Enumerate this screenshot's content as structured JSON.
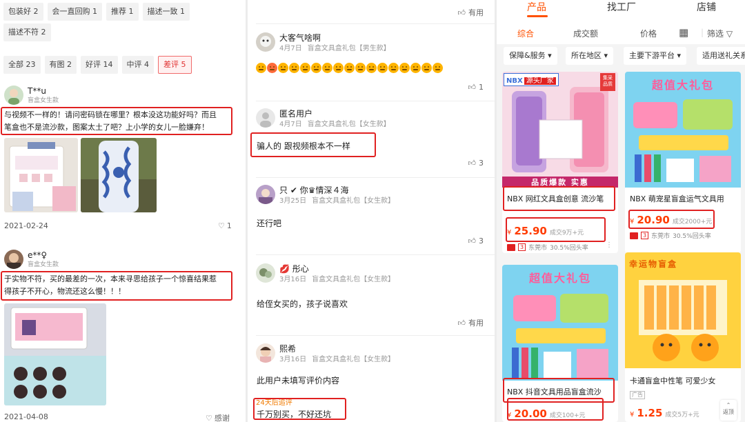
{
  "left": {
    "chips_row1": [
      "包装好 2",
      "会一直回购 1",
      "推荐 1",
      "描述一致 1"
    ],
    "chip_row2": "描述不符 2",
    "filters": [
      "全部 23",
      "有图 2",
      "好评 14",
      "中评 4",
      "差评 5"
    ],
    "reviews": [
      {
        "user": "T**u",
        "tag": "盲盒女生款",
        "text_line1": "与视频不一样的！请问密码锁在哪里？根本没这功能好吗？而且",
        "text_line2": "笔盒也不是流沙款，图案太土了吧？上小学的女儿一脸嫌弃！",
        "date": "2021-02-24",
        "likes": "1"
      },
      {
        "user": "e**♀",
        "tag": "盲盒女生款",
        "text_line1": "于实物不符，买的最差的一次，本来寻思给孩子一个惊喜结果惹",
        "text_line2": "得孩子不开心，物流还这么慢！！！",
        "date": "2021-04-08",
        "likes": "感谢"
      }
    ]
  },
  "middle": {
    "top_useful": "有用",
    "reviews": [
      {
        "user": "大客气啥啊",
        "date": "4月7日",
        "spec": "盲盒文具盒礼包【男生款】",
        "likes": "1"
      },
      {
        "user": "匿名用户",
        "date": "4月7日",
        "spec": "盲盒文具盒礼包【女生款】",
        "text": "骗人的 跟视频根本不一样",
        "likes": "3"
      },
      {
        "user": "只 ✔ 你♛情深４海",
        "date": "3月25日",
        "spec": "盲盒文具盒礼包【女生款】",
        "text": "还行吧",
        "likes": "3"
      },
      {
        "user": "💋 彤心",
        "date": "3月16日",
        "spec": "盲盒文具盒礼包【女生款】",
        "text": "给侄女买的，孩子说喜欢",
        "likes": "有用"
      },
      {
        "user": "熙希",
        "date": "3月16日",
        "spec": "盲盒文具盒礼包【女生款】",
        "text": "此用户未填写评价内容",
        "followup_label": "24天后追评",
        "followup_text": "千万别买，不好还坑"
      }
    ]
  },
  "right": {
    "tabs": [
      "产品",
      "找工厂",
      "店铺"
    ],
    "sort": [
      "综合",
      "成交额",
      "价格",
      "筛选"
    ],
    "filters": [
      "保障&服务 ▾",
      "所在地区 ▾",
      "主要下游平台 ▾",
      "适用送礼关系"
    ],
    "products": [
      {
        "brand": "NBX",
        "badge": "源头厂家",
        "title": "NBX 网红文具盒创意 流沙笔",
        "price": "25.90",
        "sales": "成交9万+元",
        "loc": "东莞市",
        "loc_num": "3",
        "repeat": "30.5%回头率",
        "banner": "品质爆款 实惠"
      },
      {
        "title": "NBX 萌宠星盲盒运气文具用",
        "price": "20.90",
        "sales": "成交2000+元",
        "loc": "东莞市",
        "loc_num": "3",
        "repeat": "30.5%回头率",
        "banner": "超值大礼包"
      },
      {
        "title": "NBX 抖音文具用品盲盒流沙",
        "price": "20.00",
        "sales": "成交100+元",
        "banner": "超值大礼包"
      },
      {
        "title": "卡通盲盒中性笔 可爱少女",
        "price": "1.25",
        "sales": "成交5万+元",
        "ad": "广告",
        "banner": "幸运物盲盒"
      }
    ],
    "back_top": "返顶",
    "corner_badge": "集采 品质"
  },
  "colors": {
    "accent": "#ff5000",
    "price": "#ff3b00",
    "highlight_box": "#e02020"
  }
}
